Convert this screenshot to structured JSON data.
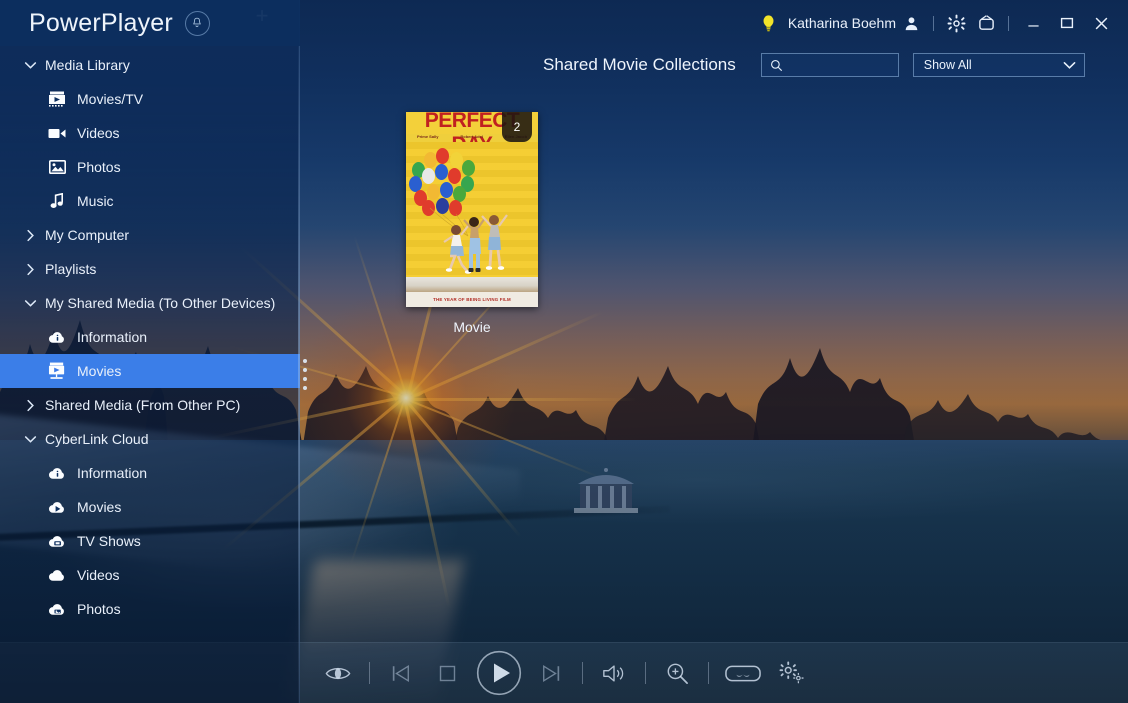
{
  "app": {
    "title": "PowerPlayer",
    "notification_icon": "bell-icon"
  },
  "titlebar": {
    "tip_icon": "lightbulb-icon",
    "username": "Katharina Boehm",
    "account_icon": "user-account-icon",
    "settings_icon": "gear-icon",
    "tv_icon": "tv-mode-icon",
    "minimize_label": "—",
    "maximize_label": "□",
    "close_label": "✕"
  },
  "sidebar": {
    "add_label": "+",
    "items": [
      {
        "label": "Media Library",
        "level": "group",
        "icon": "chevron-down-icon",
        "expanded": true,
        "selected": false
      },
      {
        "label": "Movies/TV",
        "level": "child",
        "icon": "film-strip-icon",
        "selected": false
      },
      {
        "label": "Videos",
        "level": "child",
        "icon": "video-camera-icon",
        "selected": false
      },
      {
        "label": "Photos",
        "level": "child",
        "icon": "photo-icon",
        "selected": false
      },
      {
        "label": "Music",
        "level": "child",
        "icon": "music-note-icon",
        "selected": false
      },
      {
        "label": "My Computer",
        "level": "group",
        "icon": "chevron-right-icon",
        "expanded": false,
        "selected": false
      },
      {
        "label": "Playlists",
        "level": "group",
        "icon": "chevron-right-icon",
        "expanded": false,
        "selected": false
      },
      {
        "label": "My Shared Media (To Other Devices)",
        "level": "group",
        "icon": "chevron-down-icon",
        "expanded": true,
        "selected": false
      },
      {
        "label": "Information",
        "level": "child",
        "icon": "cloud-info-icon",
        "selected": false
      },
      {
        "label": "Movies",
        "level": "child",
        "icon": "shared-movie-icon",
        "selected": true
      },
      {
        "label": "Shared Media (From Other PC)",
        "level": "group",
        "icon": "chevron-right-icon",
        "expanded": false,
        "selected": false
      },
      {
        "label": "CyberLink Cloud",
        "level": "group",
        "icon": "chevron-down-icon",
        "expanded": true,
        "selected": false
      },
      {
        "label": "Information",
        "level": "child",
        "icon": "cloud-info-icon",
        "selected": false
      },
      {
        "label": "Movies",
        "level": "child",
        "icon": "cloud-movie-icon",
        "selected": false
      },
      {
        "label": "TV Shows",
        "level": "child",
        "icon": "cloud-tv-icon",
        "selected": false
      },
      {
        "label": "Videos",
        "level": "child",
        "icon": "cloud-video-icon",
        "selected": false
      },
      {
        "label": "Photos",
        "level": "child",
        "icon": "cloud-photo-icon",
        "selected": false
      }
    ]
  },
  "content": {
    "heading": "Shared Movie Collections",
    "search": {
      "value": "",
      "placeholder": "",
      "icon": "search-icon"
    },
    "filter": {
      "selected": "Show All",
      "icon": "chevron-down-icon"
    },
    "tiles": [
      {
        "label": "Movie",
        "badge": "2",
        "poster_title": "PERFECT DAY",
        "poster_credits": [
          "Prime Sally",
          "Robert Adel",
          "Ellen Jacob"
        ],
        "poster_tagline": "THE YEAR OF BEING LIVING FILM"
      }
    ]
  },
  "playbar": {
    "controls": [
      {
        "name": "3d-eye-icon",
        "label": "3D"
      },
      {
        "name": "previous-icon",
        "label": "Previous"
      },
      {
        "name": "stop-icon",
        "label": "Stop"
      },
      {
        "name": "play-icon",
        "label": "Play"
      },
      {
        "name": "next-icon",
        "label": "Next"
      },
      {
        "name": "volume-icon",
        "label": "Volume"
      },
      {
        "name": "zoom-in-icon",
        "label": "Zoom"
      },
      {
        "name": "vr-goggles-icon",
        "label": "VR Mode"
      },
      {
        "name": "settings-gear-icon",
        "label": "Settings"
      }
    ]
  },
  "colors": {
    "accent_selected": "#3b7ae8",
    "panel_blue": "#0d2f5f",
    "text_primary": "#eef4fc",
    "bulb_yellow": "#f2e42a",
    "poster_yellow": "#f5cc2e",
    "poster_title_red": "#c02020"
  }
}
